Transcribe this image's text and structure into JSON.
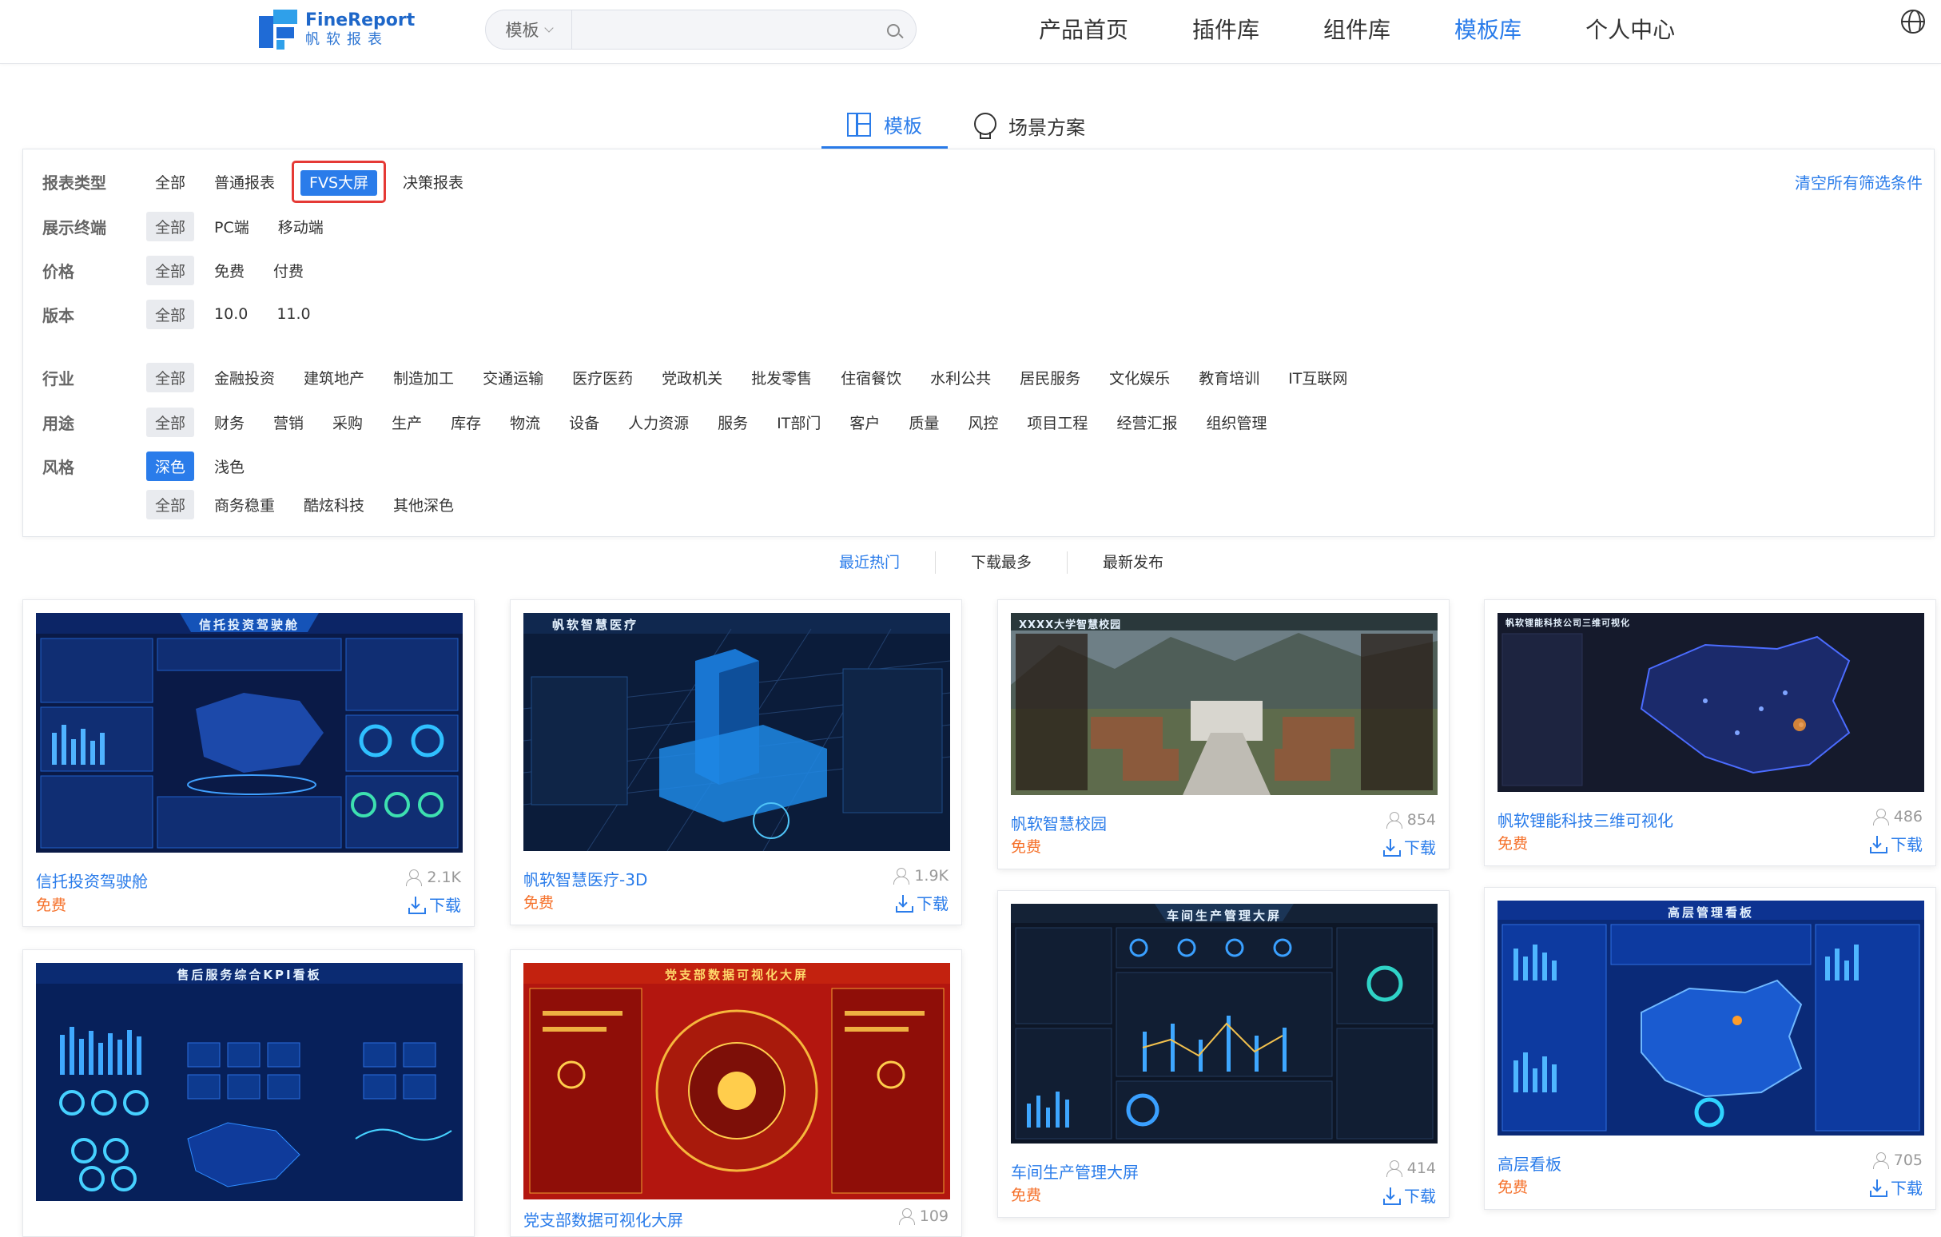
{
  "header": {
    "logo_en": "FineReport",
    "logo_cn": "帆软报表",
    "search_type": "模板",
    "search_placeholder": "",
    "nav": [
      "产品首页",
      "插件库",
      "组件库",
      "模板库",
      "个人中心"
    ],
    "nav_active_index": 3
  },
  "tabs": [
    {
      "label": "模板",
      "icon": "grid-icon",
      "active": true
    },
    {
      "label": "场景方案",
      "icon": "bulb-icon",
      "active": false
    }
  ],
  "filters": {
    "clear_label": "清空所有筛选条件",
    "report_type": {
      "label": "报表类型",
      "options": [
        "全部",
        "普通报表",
        "FVS大屏",
        "决策报表"
      ],
      "selected": "FVS大屏"
    },
    "terminal": {
      "label": "展示终端",
      "options": [
        "全部",
        "PC端",
        "移动端"
      ],
      "selected": "全部"
    },
    "price": {
      "label": "价格",
      "options": [
        "全部",
        "免费",
        "付费"
      ],
      "selected": "全部"
    },
    "version": {
      "label": "版本",
      "options": [
        "全部",
        "10.0",
        "11.0"
      ],
      "selected": "全部"
    },
    "industry": {
      "label": "行业",
      "options": [
        "全部",
        "金融投资",
        "建筑地产",
        "制造加工",
        "交通运输",
        "医疗医药",
        "党政机关",
        "批发零售",
        "住宿餐饮",
        "水利公共",
        "居民服务",
        "文化娱乐",
        "教育培训",
        "IT互联网"
      ],
      "selected": "全部"
    },
    "usage": {
      "label": "用途",
      "options": [
        "全部",
        "财务",
        "营销",
        "采购",
        "生产",
        "库存",
        "物流",
        "设备",
        "人力资源",
        "服务",
        "IT部门",
        "客户",
        "质量",
        "风控",
        "项目工程",
        "经营汇报",
        "组织管理"
      ],
      "selected": "全部"
    },
    "style": {
      "label": "风格",
      "options": [
        "深色",
        "浅色"
      ],
      "selected": "深色"
    },
    "style_sub": {
      "options": [
        "全部",
        "商务稳重",
        "酷炫科技",
        "其他深色"
      ],
      "selected": "全部"
    }
  },
  "sort": {
    "options": [
      "最近热门",
      "下载最多",
      "最新发布"
    ],
    "active": "最近热门"
  },
  "cards": [
    {
      "title": "信托投资驾驶舱",
      "price": "免费",
      "views": "2.1K",
      "download": "下载",
      "dash_title": "信托投资驾驶舱"
    },
    {
      "title": "帆软智慧医疗-3D",
      "price": "免费",
      "views": "1.9K",
      "download": "下载",
      "dash_title": "帆软智慧医疗"
    },
    {
      "title": "帆软智慧校园",
      "price": "免费",
      "views": "854",
      "download": "下载",
      "dash_title": "XXXX大学智慧校园"
    },
    {
      "title": "帆软锂能科技三维可视化",
      "price": "免费",
      "views": "486",
      "download": "下载",
      "dash_title": "帆软锂能科技公司三维可视化"
    },
    {
      "title": "售后服务综合KPI看板",
      "price": "",
      "views": "",
      "download": "",
      "dash_title": "售后服务综合KPI看板"
    },
    {
      "title": "党支部数据可视化大屏",
      "price": "",
      "views": "109",
      "download": "",
      "dash_title": "党支部数据可视化大屏"
    },
    {
      "title": "车间生产管理大屏",
      "price": "免费",
      "views": "414",
      "download": "下载",
      "dash_title": "车间生产管理大屏"
    },
    {
      "title": "高层看板",
      "price": "免费",
      "views": "705",
      "download": "下载",
      "dash_title": "高层管理看板"
    }
  ],
  "colors": {
    "accent": "#2a7cea",
    "price": "#f5712b",
    "highlight_border": "#e53935"
  }
}
